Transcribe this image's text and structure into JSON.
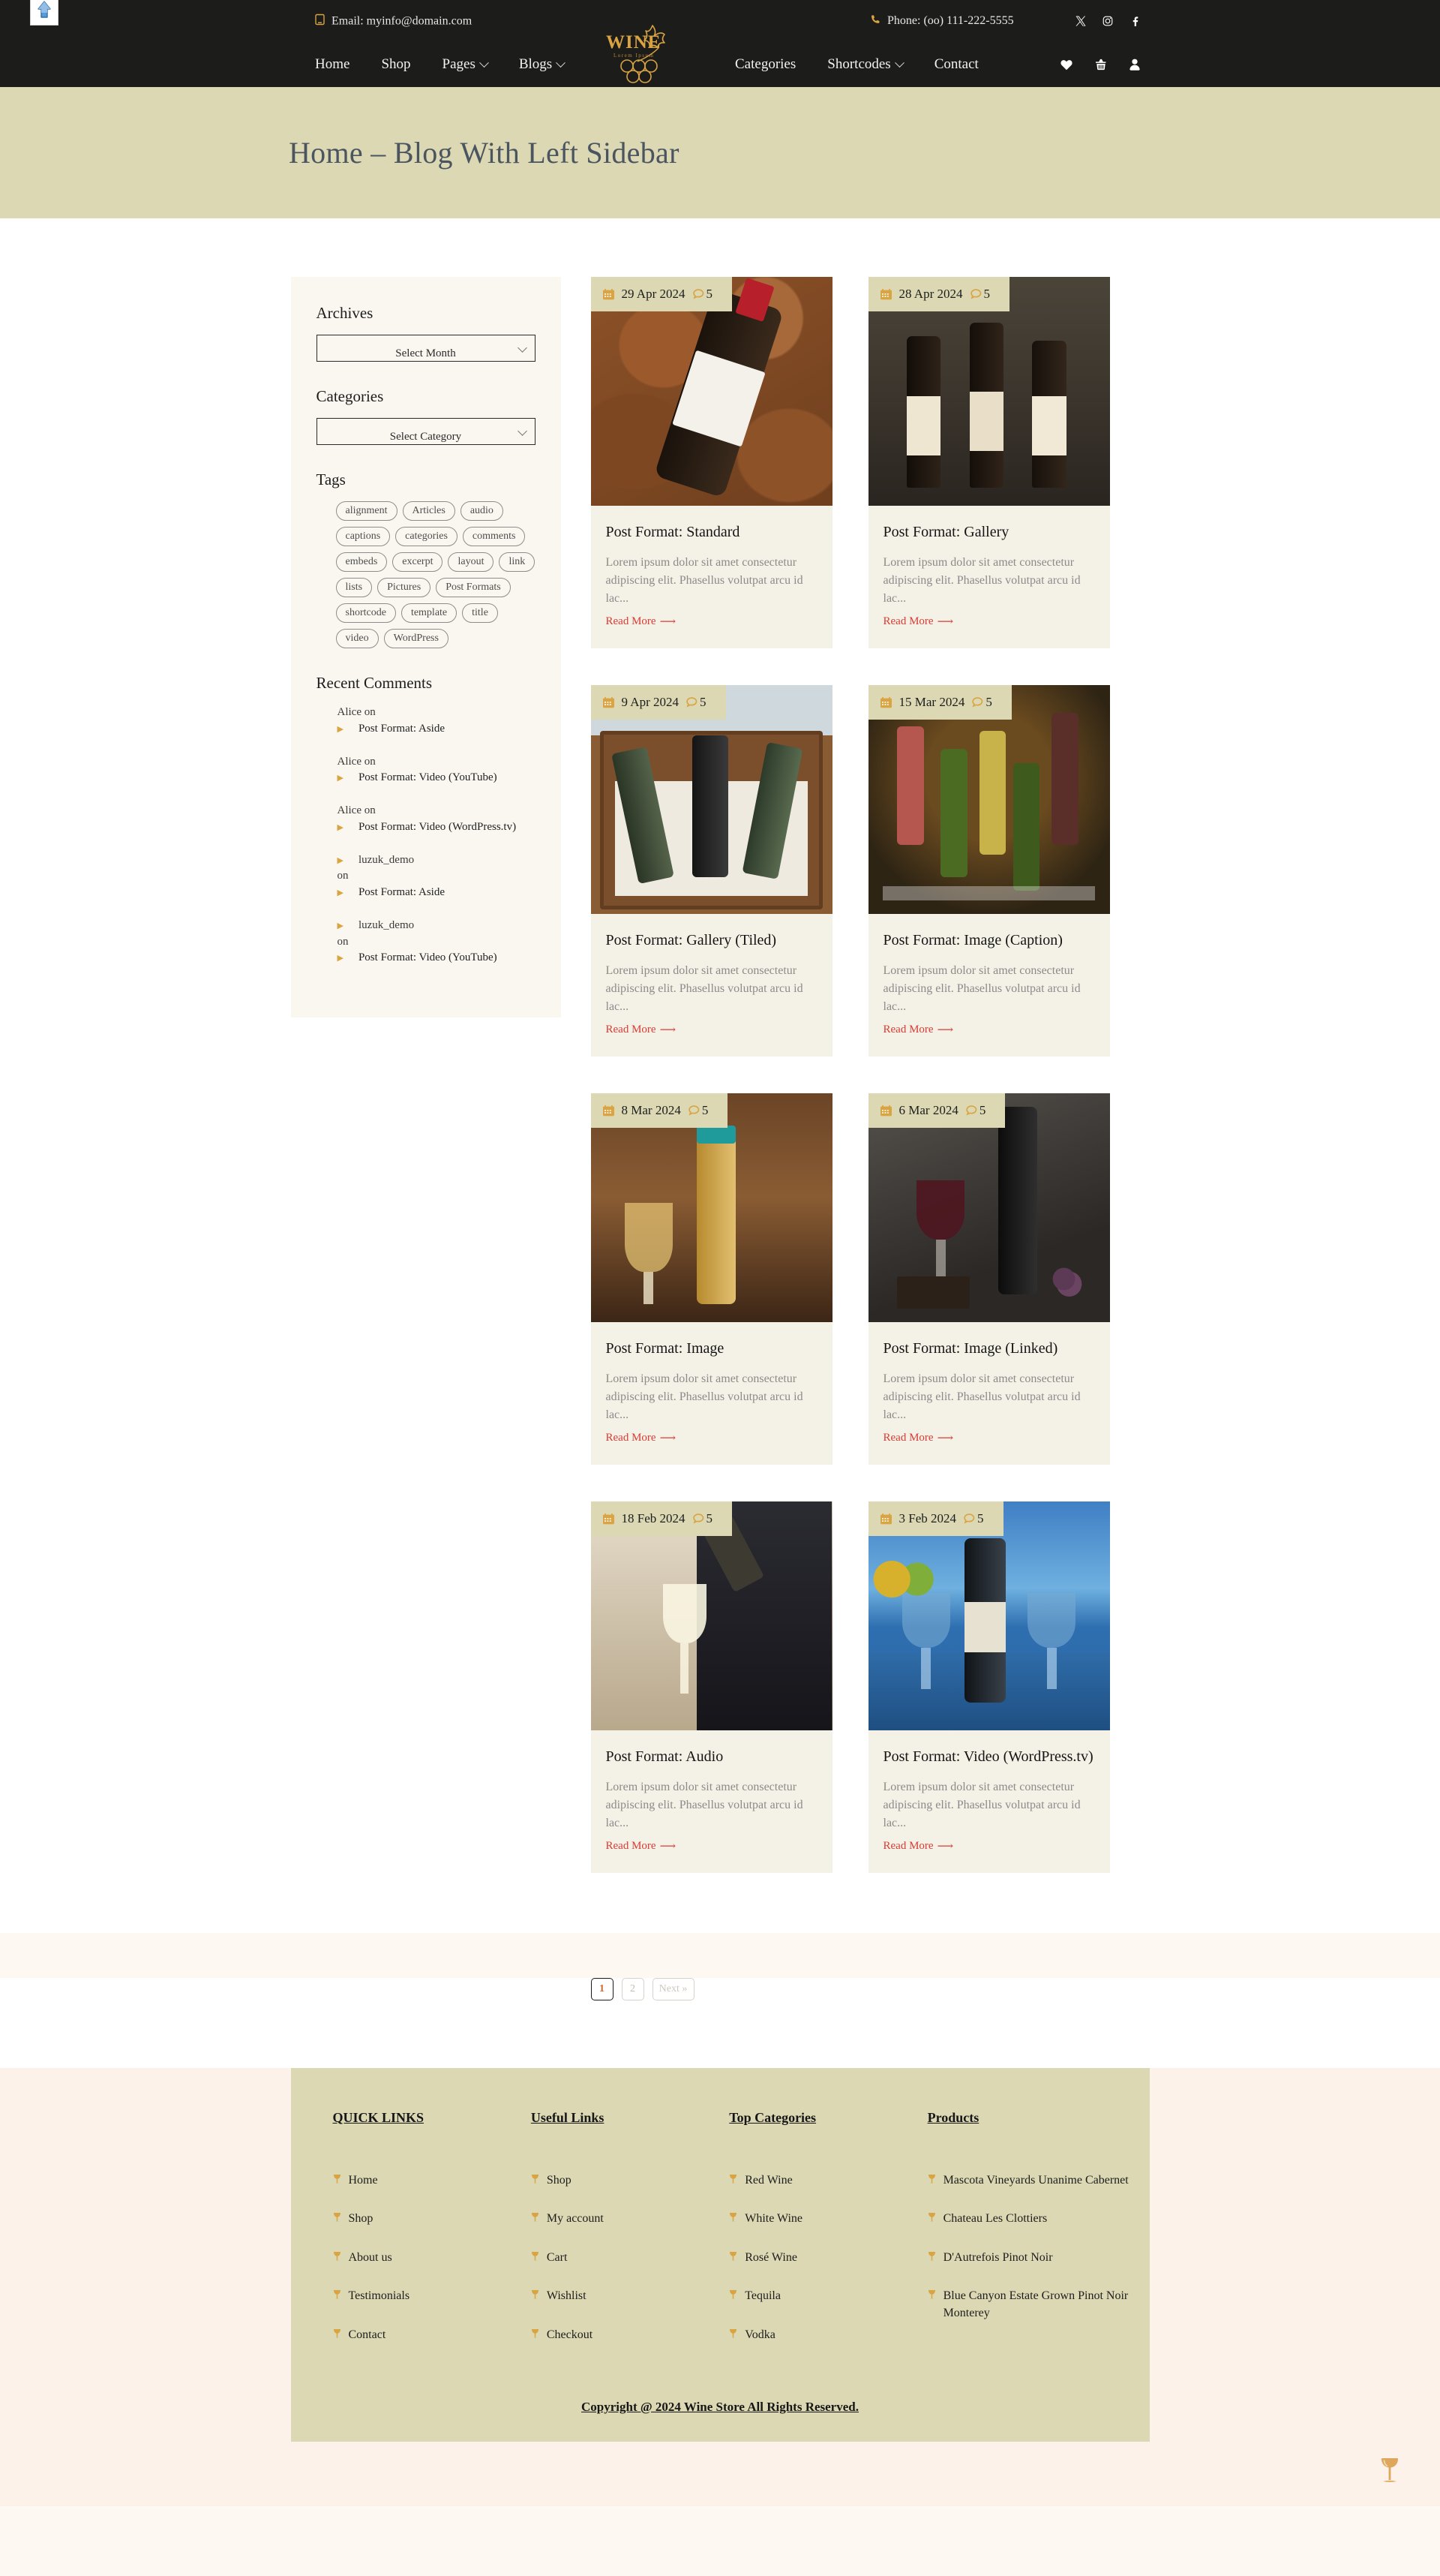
{
  "topbar": {
    "email": "Email: myinfo@domain.com",
    "phone": "Phone: (oo) 111-222-5555",
    "email_icon": "envelope-icon",
    "phone_icon": "phone-icon",
    "social": [
      "x-twitter-icon",
      "instagram-icon",
      "facebook-icon"
    ]
  },
  "logo": {
    "name": "WINE",
    "tagline": "Lorem Ipsum"
  },
  "nav": {
    "left": [
      {
        "label": "Home",
        "has_caret": false
      },
      {
        "label": "Shop",
        "has_caret": false
      },
      {
        "label": "Pages",
        "has_caret": true
      },
      {
        "label": "Blogs",
        "has_caret": true
      }
    ],
    "right": [
      {
        "label": "Categories",
        "has_caret": false
      },
      {
        "label": "Shortcodes",
        "has_caret": true
      },
      {
        "label": "Contact",
        "has_caret": false
      }
    ],
    "icons": [
      "heart-icon",
      "basket-icon",
      "user-icon"
    ]
  },
  "page_title": "Home – Blog With Left Sidebar",
  "sidebar": {
    "archives": {
      "title": "Archives",
      "select_value": "Select Month"
    },
    "categories": {
      "title": "Categories",
      "select_value": "Select Category"
    },
    "tags": {
      "title": "Tags",
      "items": [
        "alignment",
        "Articles",
        "audio",
        "captions",
        "categories",
        "comments",
        "embeds",
        "excerpt",
        "layout",
        "link",
        "lists",
        "Pictures",
        "Post Formats",
        "shortcode",
        "template",
        "title",
        "video",
        "WordPress"
      ]
    },
    "recent_comments": {
      "title": "Recent Comments",
      "items": [
        {
          "author": "Alice",
          "on": "on",
          "post": "Post Format: Aside",
          "author_linked": false
        },
        {
          "author": "Alice",
          "on": "on",
          "post": "Post Format: Video (YouTube)",
          "author_linked": false
        },
        {
          "author": "Alice",
          "on": "on",
          "post": "Post Format: Video (WordPress.tv)",
          "author_linked": false
        },
        {
          "author": "luzuk_demo",
          "on": "on",
          "post": "Post Format: Aside",
          "author_linked": true
        },
        {
          "author": "luzuk_demo",
          "on": "on",
          "post": "Post Format: Video (YouTube)",
          "author_linked": true
        }
      ]
    }
  },
  "posts": {
    "excerpt": "Lorem ipsum dolor sit amet consectetur adipiscing elit. Phasellus volutpat arcu id lac...",
    "read_more": "Read More",
    "items": [
      {
        "date": "29 Apr 2024",
        "comments": "5",
        "title": "Post Format: Standard",
        "scene": "leaves"
      },
      {
        "date": "28 Apr 2024",
        "comments": "5",
        "title": "Post Format: Gallery",
        "scene": "trio"
      },
      {
        "date": "9 Apr 2024",
        "comments": "5",
        "title": "Post Format: Gallery (Tiled)",
        "scene": "crate"
      },
      {
        "date": "15 Mar 2024",
        "comments": "5",
        "title": "Post Format: Image (Caption)",
        "scene": "shelf"
      },
      {
        "date": "8 Mar 2024",
        "comments": "5",
        "title": "Post Format: Image",
        "scene": "bar"
      },
      {
        "date": "6 Mar 2024",
        "comments": "5",
        "title": "Post Format: Image (Linked)",
        "scene": "dark"
      },
      {
        "date": "18 Feb 2024",
        "comments": "5",
        "title": "Post Format: Audio",
        "scene": "pour"
      },
      {
        "date": "3 Feb 2024",
        "comments": "5",
        "title": "Post Format: Video (WordPress.tv)",
        "scene": "sea"
      }
    ]
  },
  "pagination": {
    "pages": [
      "1",
      "2"
    ],
    "active": "1",
    "next": "Next »"
  },
  "footer": {
    "columns": [
      {
        "heading": "QUICK LINKS",
        "links": [
          "Home",
          "Shop",
          "About us",
          "Testimonials",
          "Contact"
        ]
      },
      {
        "heading": "Useful Links",
        "links": [
          "Shop",
          "My account",
          "Cart",
          "Wishlist",
          "Checkout"
        ]
      },
      {
        "heading": "Top Categories",
        "links": [
          "Red Wine",
          "White Wine",
          "Rosé Wine",
          "Tequila",
          "Vodka"
        ]
      },
      {
        "heading": "Products",
        "links": [
          "Mascota Vineyards Unanime Cabernet",
          "Chateau Les Clottiers",
          "D'Autrefois Pinot Noir",
          "Blue Canyon Estate Grown Pinot Noir Monterey"
        ]
      }
    ],
    "copyright": "Copyright @ 2024 Wine Store All Rights Reserved.",
    "scroll_top_icon": "wine-glass-icon"
  },
  "colors": {
    "dark": "#1c1c1b",
    "gold": "#d9a441",
    "band": "#dbd8b3",
    "card_body": "#f4f1e6",
    "read_more": "#d93b34",
    "page_bg": "#fdf2e9"
  }
}
